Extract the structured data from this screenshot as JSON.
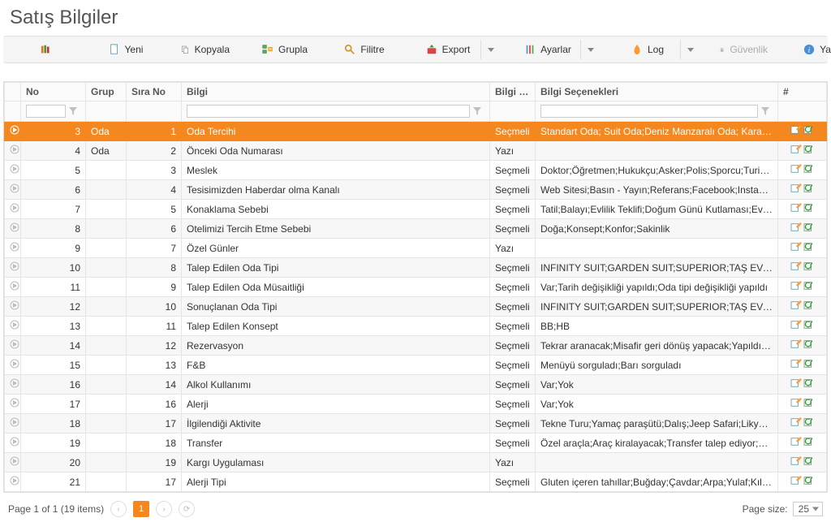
{
  "title": "Satış Bilgiler",
  "toolbar": {
    "yeni": "Yeni",
    "kopyala": "Kopyala",
    "grupla": "Grupla",
    "filtre": "Filitre",
    "export": "Export",
    "ayarlar": "Ayarlar",
    "log": "Log",
    "guvenlik": "Güvenlik",
    "yardim": "Yardım"
  },
  "columns": {
    "no": "No",
    "grup": "Grup",
    "sira": "Sıra No",
    "bilgi": "Bilgi",
    "tipi": "Bilgi Tipi",
    "sec": "Bilgi Seçenekleri",
    "act": "#"
  },
  "rows": [
    {
      "no": "3",
      "grup": "Oda",
      "sira": "1",
      "bilgi": "Oda Tercihi",
      "tipi": "Seçmeli",
      "sec": "Standart Oda; Suit Oda;Deniz Manzaralı Oda; Kara Manzaralı Oda;F",
      "selected": true
    },
    {
      "no": "4",
      "grup": "Oda",
      "sira": "2",
      "bilgi": "Önceki Oda Numarası",
      "tipi": "Yazı",
      "sec": ""
    },
    {
      "no": "5",
      "grup": "",
      "sira": "3",
      "bilgi": "Meslek",
      "tipi": "Seçmeli",
      "sec": "Doktor;Öğretmen;Hukukçu;Asker;Polis;Sporcu;Turizmci;Tıp;İnşaat;E"
    },
    {
      "no": "6",
      "grup": "",
      "sira": "4",
      "bilgi": "Tesisimizden Haberdar olma Kanalı",
      "tipi": "Seçmeli",
      "sec": "Web Sitesi;Basın - Yayın;Referans;Facebook;Instagram;Tripadvisor"
    },
    {
      "no": "7",
      "grup": "",
      "sira": "5",
      "bilgi": "Konaklama Sebebi",
      "tipi": "Seçmeli",
      "sec": "Tatil;Balayı;Evlilik Teklifi;Doğum Günü Kutlaması;Evllik Yıldönümü;Ta"
    },
    {
      "no": "8",
      "grup": "",
      "sira": "6",
      "bilgi": "Otelimizi Tercih Etme Sebebi",
      "tipi": "Seçmeli",
      "sec": "Doğa;Konsept;Konfor;Sakinlik"
    },
    {
      "no": "9",
      "grup": "",
      "sira": "7",
      "bilgi": "Özel Günler",
      "tipi": "Yazı",
      "sec": ""
    },
    {
      "no": "10",
      "grup": "",
      "sira": "8",
      "bilgi": "Talep Edilen Oda Tipi",
      "tipi": "Seçmeli",
      "sec": "INFINITY SUIT;GARDEN SUIT;SUPERIOR;TAŞ EV;JAKUZİLİ TAŞ EV;BA"
    },
    {
      "no": "11",
      "grup": "",
      "sira": "9",
      "bilgi": "Talep Edilen Oda Müsaitliği",
      "tipi": "Seçmeli",
      "sec": "Var;Tarih değişikliği yapıldı;Oda tipi değişikliği yapıldı"
    },
    {
      "no": "12",
      "grup": "",
      "sira": "10",
      "bilgi": "Sonuçlanan Oda Tipi",
      "tipi": "Seçmeli",
      "sec": "INFINITY SUIT;GARDEN SUIT;SUPERIOR;TAŞ EV;JAKUZİLİ TAŞ EV;BA"
    },
    {
      "no": "13",
      "grup": "",
      "sira": "11",
      "bilgi": "Talep Edilen Konsept",
      "tipi": "Seçmeli",
      "sec": "BB;HB"
    },
    {
      "no": "14",
      "grup": "",
      "sira": "12",
      "bilgi": "Rezervasyon",
      "tipi": "Seçmeli",
      "sec": "Tekrar aranacak;Misafir geri dönüş yapacak;Yapıldı;Ücret yüksek;Mü"
    },
    {
      "no": "15",
      "grup": "",
      "sira": "13",
      "bilgi": "F&B",
      "tipi": "Seçmeli",
      "sec": "Menüyü sorguladı;Barı sorguladı"
    },
    {
      "no": "16",
      "grup": "",
      "sira": "14",
      "bilgi": "Alkol Kullanımı",
      "tipi": "Seçmeli",
      "sec": "Var;Yok"
    },
    {
      "no": "17",
      "grup": "",
      "sira": "16",
      "bilgi": "Alerji",
      "tipi": "Seçmeli",
      "sec": "Var;Yok"
    },
    {
      "no": "18",
      "grup": "",
      "sira": "17",
      "bilgi": "İlgilendiği Aktivite",
      "tipi": "Seçmeli",
      "sec": "Tekne Turu;Yamaç paraşütü;Dalış;Jeep Safari;Likya yolu yürüyüş;Spa"
    },
    {
      "no": "19",
      "grup": "",
      "sira": "18",
      "bilgi": "Transfer",
      "tipi": "Seçmeli",
      "sec": "Özel araçla;Araç kiralayacak;Transfer talep ediyor;Toplu taşıma ile g"
    },
    {
      "no": "20",
      "grup": "",
      "sira": "19",
      "bilgi": "Kargı Uygulaması",
      "tipi": "Yazı",
      "sec": ""
    },
    {
      "no": "21",
      "grup": "",
      "sira": "17",
      "bilgi": "Alerji Tipi",
      "tipi": "Seçmeli",
      "sec": "Gluten içeren tahıllar;Buğday;Çavdar;Arpa;Yulaf;Kılçıksız buğday;Ka"
    }
  ],
  "pager": {
    "summary": "Page 1 of 1 (19 items)",
    "current": "1",
    "sizeLabel": "Page size:",
    "size": "25"
  }
}
